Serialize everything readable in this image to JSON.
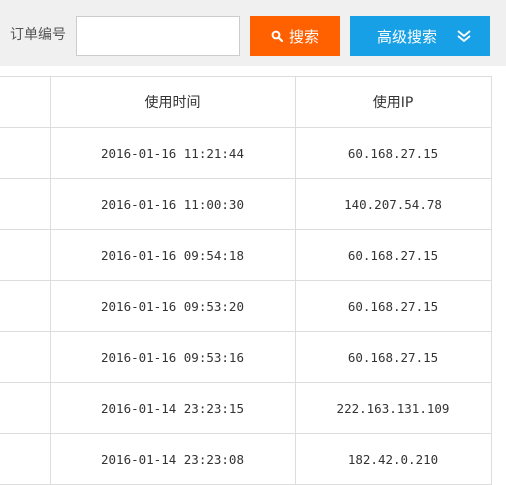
{
  "search": {
    "order_label": "订单编号",
    "order_value": "",
    "search_button": "搜索",
    "advanced_button": "高级搜索"
  },
  "table": {
    "headers": [
      "",
      "使用时间",
      "使用IP"
    ],
    "rows": [
      {
        "time": "2016-01-16 11:21:44",
        "ip": "60.168.27.15"
      },
      {
        "time": "2016-01-16 11:00:30",
        "ip": "140.207.54.78"
      },
      {
        "time": "2016-01-16 09:54:18",
        "ip": "60.168.27.15"
      },
      {
        "time": "2016-01-16 09:53:20",
        "ip": "60.168.27.15"
      },
      {
        "time": "2016-01-16 09:53:16",
        "ip": "60.168.27.15"
      },
      {
        "time": "2016-01-14 23:23:15",
        "ip": "222.163.131.109"
      },
      {
        "time": "2016-01-14 23:23:08",
        "ip": "182.42.0.210"
      }
    ]
  },
  "colors": {
    "search_button": "#ff6000",
    "advanced_button": "#17a0e6",
    "toolbar_bg": "#f0f0f0",
    "border": "#dddddd"
  },
  "icons": {
    "search_button_icon": "search-icon",
    "advanced_button_icon": "double-chevron-down-icon"
  }
}
